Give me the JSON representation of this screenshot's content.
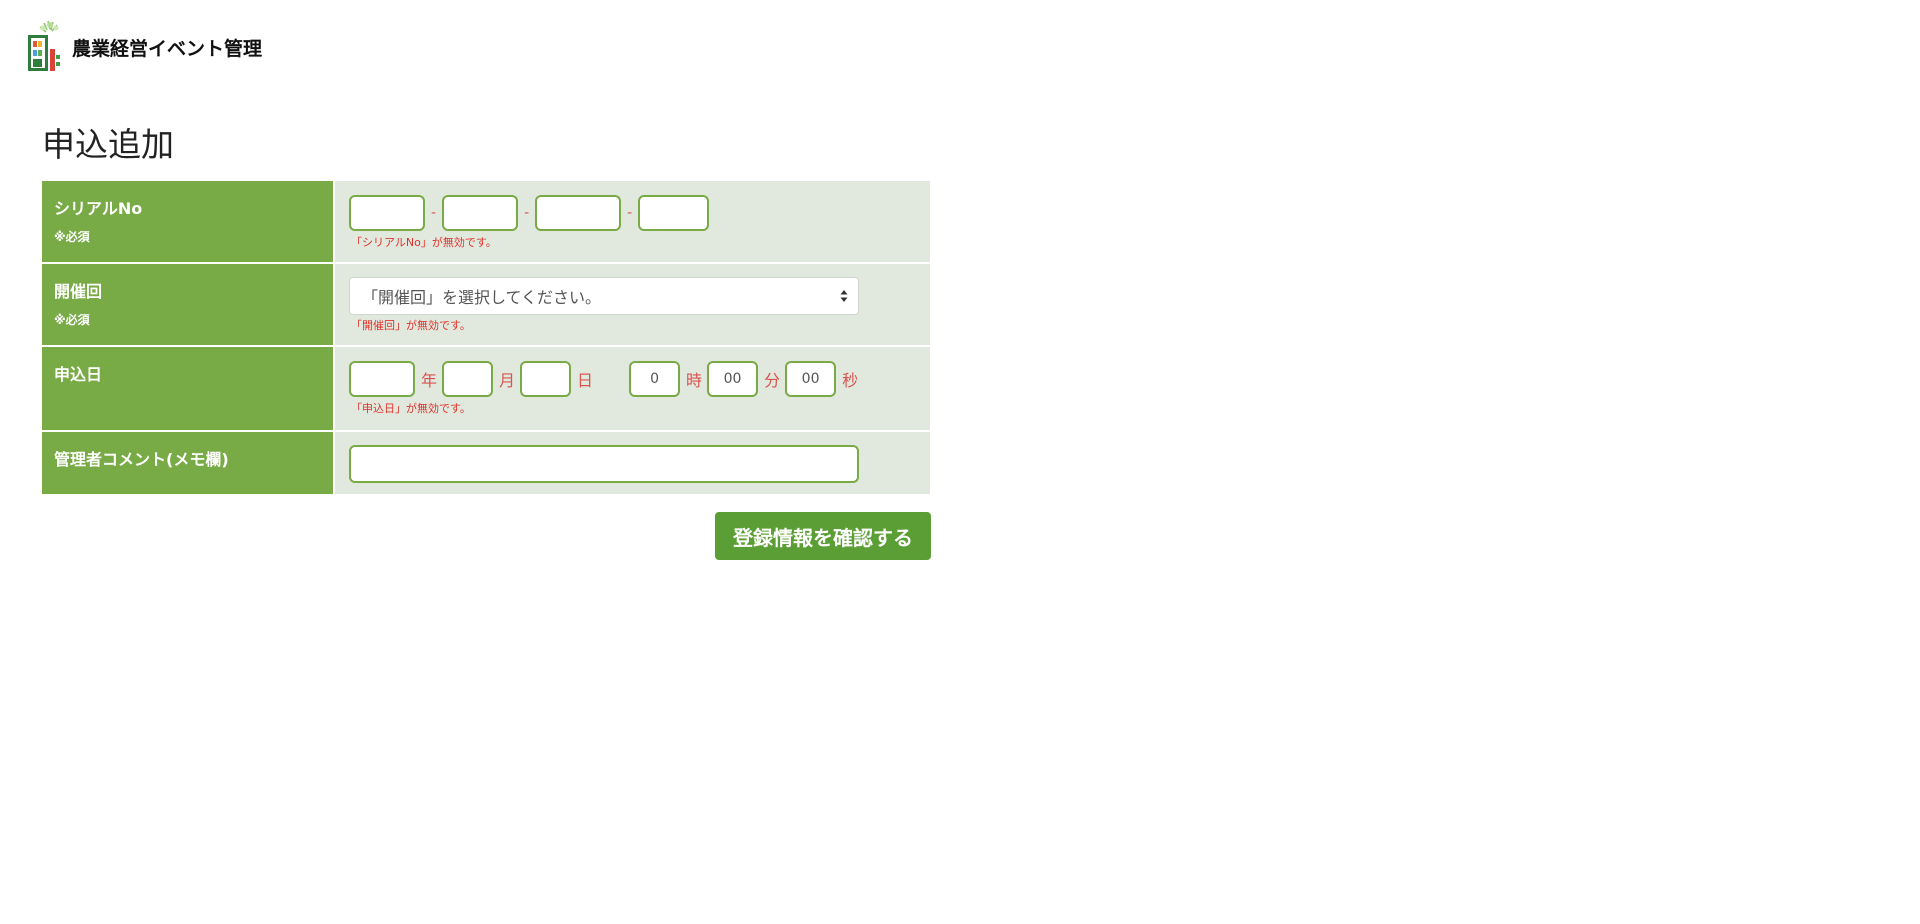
{
  "header": {
    "app_title": "農業経営イベント管理",
    "logo_icon": "farm-building-icon"
  },
  "page": {
    "title": "申込追加"
  },
  "colors": {
    "label_bg": "#78ab46",
    "field_bg": "#e1e9df",
    "input_border": "#78ab46",
    "error_text": "#e0342c",
    "button_bg": "#5c9e36"
  },
  "form": {
    "serial": {
      "label": "シリアルNo",
      "required": "※必須",
      "separator": "-",
      "values": [
        "",
        "",
        "",
        ""
      ],
      "error": "「シリアルNo」が無効です。"
    },
    "session": {
      "label": "開催回",
      "required": "※必須",
      "selected": "「開催回」を選択してください。",
      "error": "「開催回」が無効です。"
    },
    "apply_date": {
      "label": "申込日",
      "year_value": "",
      "year_unit": "年",
      "month_value": "",
      "month_unit": "月",
      "day_value": "",
      "day_unit": "日",
      "hour_value": "0",
      "hour_unit": "時",
      "minute_value": "00",
      "minute_unit": "分",
      "second_value": "00",
      "second_unit": "秒",
      "error": "「申込日」が無効です。"
    },
    "comment": {
      "label": "管理者コメント(メモ欄)",
      "value": ""
    }
  },
  "actions": {
    "confirm_label": "登録情報を確認する"
  }
}
